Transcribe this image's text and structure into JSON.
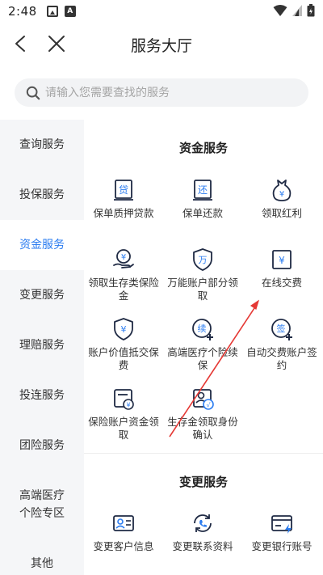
{
  "status_bar": {
    "time": "2:48",
    "icons": [
      "image-icon",
      "a-icon",
      "wifi-icon",
      "signal-icon",
      "battery-icon"
    ]
  },
  "header": {
    "title": "服务大厅",
    "back_icon": "chevron-left-icon",
    "close_icon": "close-icon"
  },
  "search": {
    "placeholder": "请输入您需要查找的服务"
  },
  "sidebar": {
    "items": [
      {
        "label": "查询服务"
      },
      {
        "label": "投保服务"
      },
      {
        "label": "资金服务",
        "active": true
      },
      {
        "label": "变更服务"
      },
      {
        "label": "理赔服务"
      },
      {
        "label": "投连服务"
      },
      {
        "label": "团险服务"
      },
      {
        "label": "高端医疗个险专区"
      },
      {
        "label": "其他"
      }
    ],
    "multi_line": [
      "高端医疗",
      "个险专区"
    ]
  },
  "sections": [
    {
      "title": "资金服务",
      "items": [
        {
          "label": "保单质押贷款",
          "icon": "loan-icon",
          "glyph": "贷"
        },
        {
          "label": "保单还款",
          "icon": "repay-icon",
          "glyph": "还"
        },
        {
          "label": "领取红利",
          "icon": "money-bag-icon",
          "glyph": "¥"
        },
        {
          "label": "领取生存类保险金",
          "icon": "hand-coin-icon",
          "glyph": "¥"
        },
        {
          "label": "万能账户部分领取",
          "icon": "shield-wan-icon",
          "glyph": "万"
        },
        {
          "label": "在线交费",
          "icon": "payment-icon",
          "glyph": "¥"
        },
        {
          "label": "账户价值抵交保费",
          "icon": "shield-yen-icon",
          "glyph": "¥"
        },
        {
          "label": "高端医疗个险续保",
          "icon": "renew-icon",
          "glyph": "续"
        },
        {
          "label": "自动交费账户签约",
          "icon": "sign-icon",
          "glyph": "签"
        },
        {
          "label": "保险账户资金领取",
          "icon": "account-withdraw-icon",
          "glyph": "¥"
        },
        {
          "label": "生存金领取身份确认",
          "icon": "identity-confirm-icon",
          "glyph": "√"
        }
      ]
    },
    {
      "title": "变更服务",
      "items": [
        {
          "label": "变更客户信息",
          "icon": "id-card-icon"
        },
        {
          "label": "变更联系资料",
          "icon": "phone-refresh-icon"
        },
        {
          "label": "变更银行账号",
          "icon": "bank-card-icon"
        }
      ]
    }
  ],
  "colors": {
    "accent": "#2b7cf0",
    "annotation_arrow": "#e53935",
    "icon_stroke": "#1f2a44",
    "sidebar_bg": "#f5f6f8"
  }
}
